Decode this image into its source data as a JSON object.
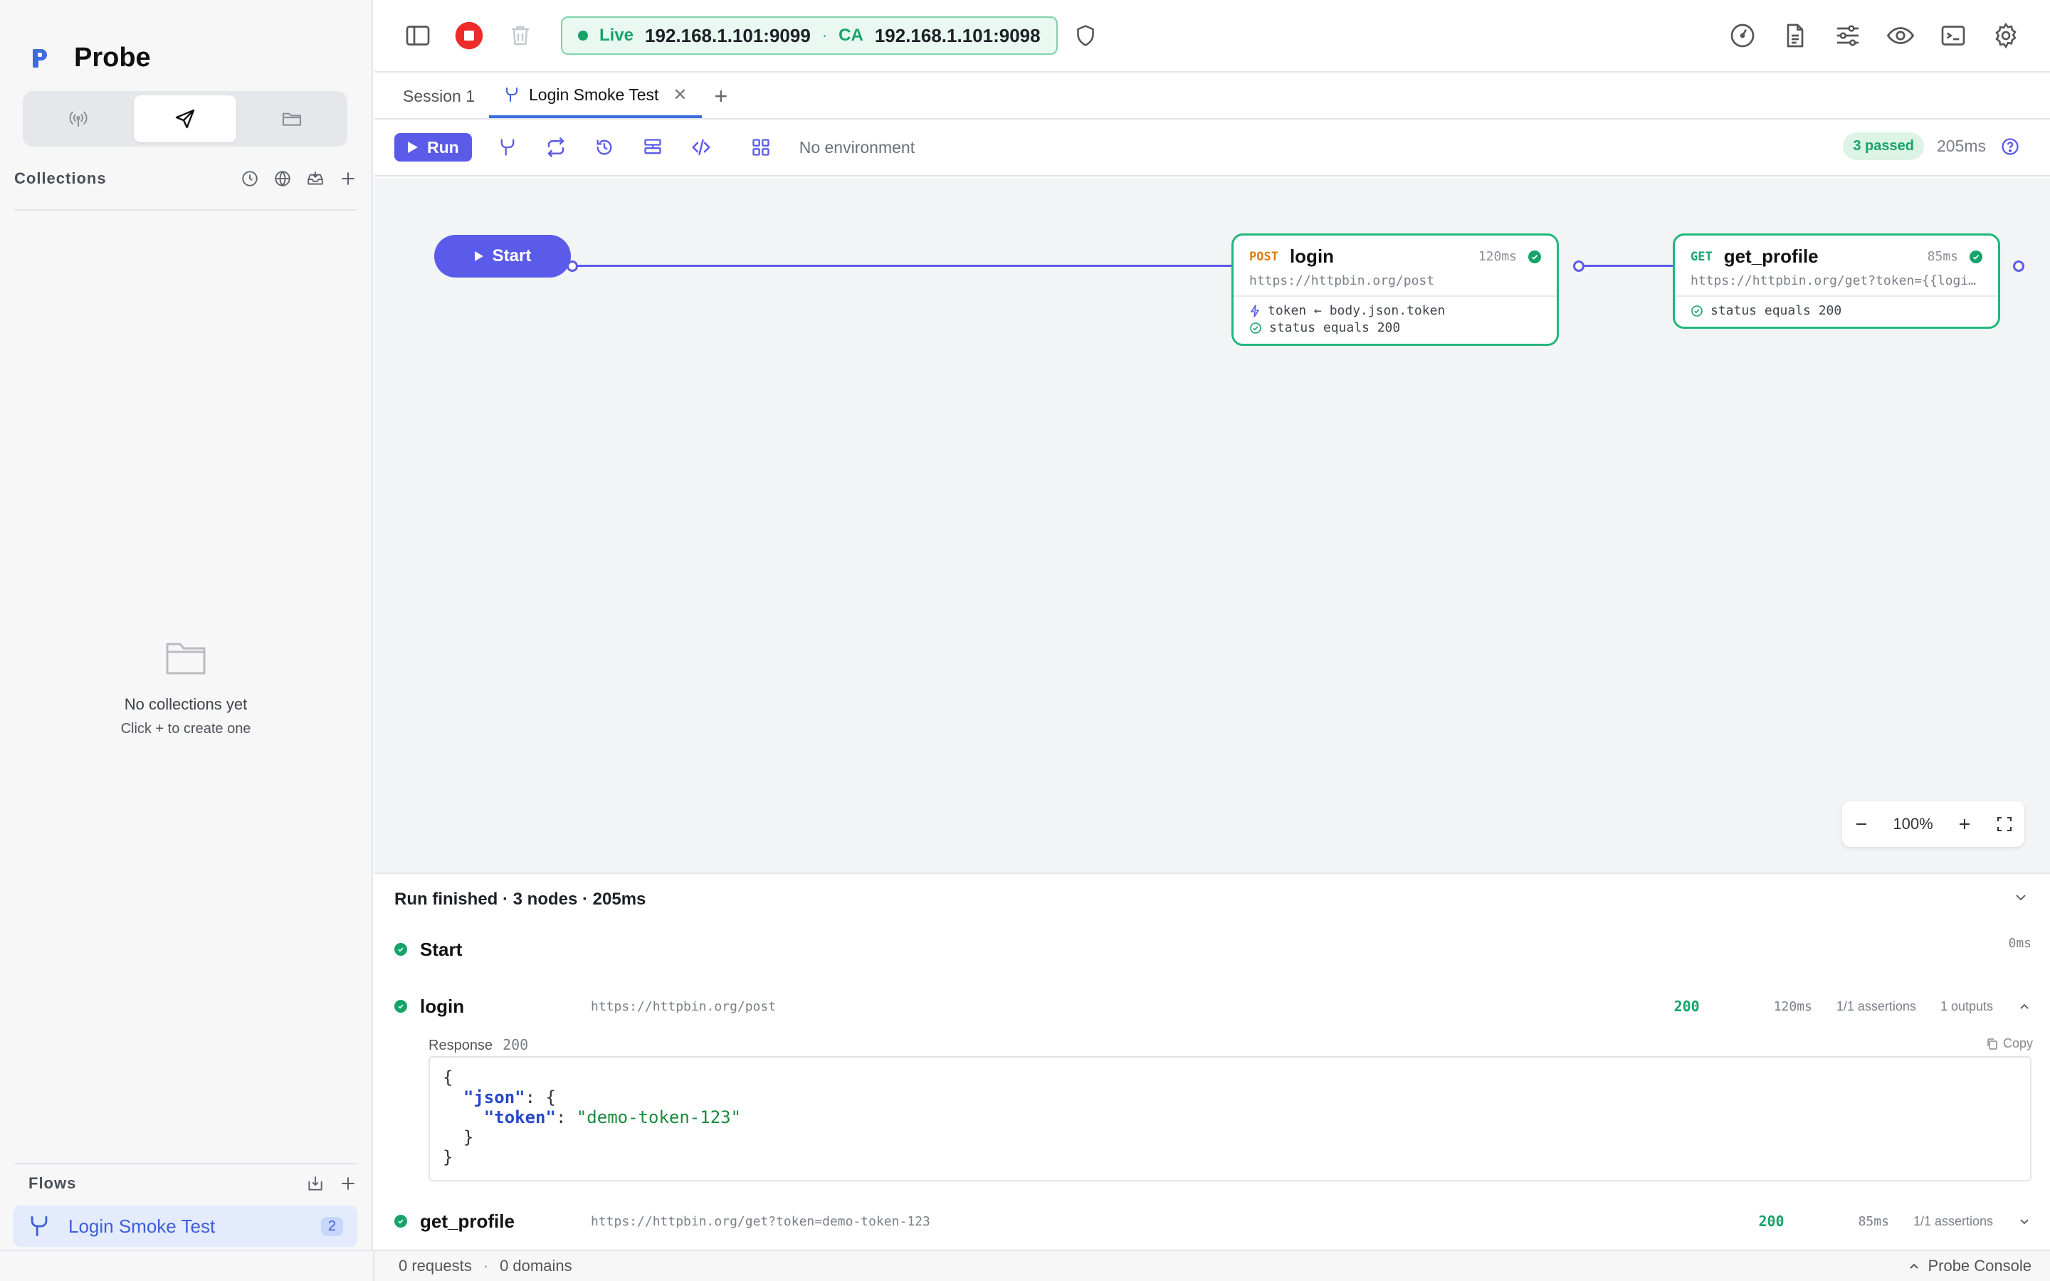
{
  "app": {
    "name": "Probe"
  },
  "sidebar": {
    "modes": [
      "broadcast-icon",
      "send-icon",
      "folder-icon"
    ],
    "collections": {
      "title": "Collections",
      "empty_title": "No collections yet",
      "empty_hint": "Click + to create one"
    },
    "flows": {
      "title": "Flows",
      "items": [
        {
          "label": "Login Smoke Test",
          "count": "2"
        }
      ]
    }
  },
  "topbar": {
    "live_label": "Live",
    "live_address": "192.168.1.101:9099",
    "ca_label": "CA",
    "ca_address": "192.168.1.101:9098"
  },
  "tabs": [
    {
      "label": "Session 1"
    },
    {
      "label": "Login Smoke Test"
    }
  ],
  "toolbar": {
    "run_label": "Run",
    "environment": "No environment",
    "passed_badge": "3 passed",
    "duration": "205ms"
  },
  "canvas": {
    "start_label": "Start",
    "nodes": [
      {
        "method": "POST",
        "name": "login",
        "time": "120ms",
        "url": "https://httpbin.org/post",
        "extract": "token ← body.json.token",
        "assertion": "status equals 200"
      },
      {
        "method": "GET",
        "name": "get_profile",
        "time": "85ms",
        "url": "https://httpbin.org/get?token={{login.token}}",
        "assertion": "status equals 200"
      }
    ],
    "zoom": "100%"
  },
  "results": {
    "header": "Run finished · 3 nodes · 205ms",
    "rows": [
      {
        "name": "Start",
        "url": "",
        "status": "",
        "time": "0ms",
        "assertions": "",
        "outputs": ""
      },
      {
        "name": "login",
        "url": "https://httpbin.org/post",
        "status": "200",
        "time": "120ms",
        "assertions": "1/1 assertions",
        "outputs": "1 outputs"
      },
      {
        "name": "get_profile",
        "url": "https://httpbin.org/get?token=demo-token-123",
        "status": "200",
        "time": "85ms",
        "assertions": "1/1 assertions",
        "outputs": ""
      }
    ],
    "response": {
      "label": "Response",
      "code": "200",
      "copy_label": "Copy",
      "body_key_outer": "\"json\"",
      "body_key_inner": "\"token\"",
      "body_value": "\"demo-token-123\""
    }
  },
  "statusbar": {
    "requests": "0 requests",
    "domains": "0 domains",
    "console": "Probe Console"
  }
}
